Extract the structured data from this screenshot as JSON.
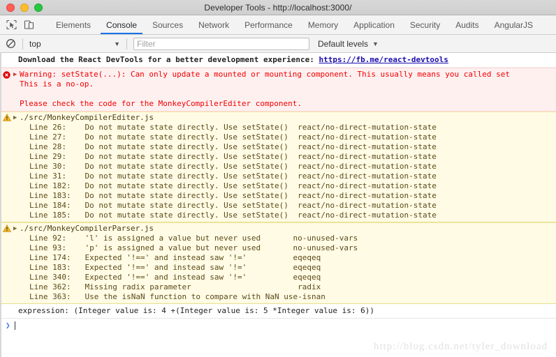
{
  "window": {
    "title": "Developer Tools - http://localhost:3000/",
    "traffic_lights": [
      "close",
      "minimize",
      "zoom"
    ],
    "colors": {
      "close": "#ff5f57",
      "minimize": "#ffbd2e",
      "zoom": "#28c840",
      "accent": "#1a73e8"
    }
  },
  "toolbar": {
    "inspect_icon": "inspect-cursor-icon",
    "device_icon": "device-toolbar-icon",
    "tabs": [
      {
        "label": "Elements",
        "active": false
      },
      {
        "label": "Console",
        "active": true
      },
      {
        "label": "Sources",
        "active": false
      },
      {
        "label": "Network",
        "active": false
      },
      {
        "label": "Performance",
        "active": false
      },
      {
        "label": "Memory",
        "active": false
      },
      {
        "label": "Application",
        "active": false
      },
      {
        "label": "Security",
        "active": false
      },
      {
        "label": "Audits",
        "active": false
      },
      {
        "label": "AngularJS",
        "active": false
      }
    ]
  },
  "filterbar": {
    "clear_icon": "clear-console-icon",
    "context": "top",
    "context_caret": "▼",
    "filter_value": "",
    "filter_placeholder": "Filter",
    "levels_label": "Default levels",
    "levels_caret": "▼"
  },
  "console": {
    "info_message": {
      "text_before": "Download the React DevTools for a better development experience: ",
      "link": "https://fb.me/react-devtools"
    },
    "error_message": {
      "icon": "error-circle-icon",
      "disclosure": "▶",
      "line1": "Warning: setState(...): Can only update a mounted or mounting component. This usually means you called set",
      "line2": "This is a no-op.",
      "line3": "Please check the code for the MonkeyCompilerEditer component."
    },
    "warning_groups": [
      {
        "icon": "warning-triangle-icon",
        "disclosure": "▶",
        "file": "./src/MonkeyCompilerEditer.js",
        "entries": [
          {
            "line": "Line 26:",
            "message": "Do not mutate state directly. Use setState()",
            "rule": "react/no-direct-mutation-state"
          },
          {
            "line": "Line 27:",
            "message": "Do not mutate state directly. Use setState()",
            "rule": "react/no-direct-mutation-state"
          },
          {
            "line": "Line 28:",
            "message": "Do not mutate state directly. Use setState()",
            "rule": "react/no-direct-mutation-state"
          },
          {
            "line": "Line 29:",
            "message": "Do not mutate state directly. Use setState()",
            "rule": "react/no-direct-mutation-state"
          },
          {
            "line": "Line 30:",
            "message": "Do not mutate state directly. Use setState()",
            "rule": "react/no-direct-mutation-state"
          },
          {
            "line": "Line 31:",
            "message": "Do not mutate state directly. Use setState()",
            "rule": "react/no-direct-mutation-state"
          },
          {
            "line": "Line 182:",
            "message": "Do not mutate state directly. Use setState()",
            "rule": "react/no-direct-mutation-state"
          },
          {
            "line": "Line 183:",
            "message": "Do not mutate state directly. Use setState()",
            "rule": "react/no-direct-mutation-state"
          },
          {
            "line": "Line 184:",
            "message": "Do not mutate state directly. Use setState()",
            "rule": "react/no-direct-mutation-state"
          },
          {
            "line": "Line 185:",
            "message": "Do not mutate state directly. Use setState()",
            "rule": "react/no-direct-mutation-state"
          }
        ]
      },
      {
        "icon": "warning-triangle-icon",
        "disclosure": "▶",
        "file": "./src/MonkeyCompilerParser.js",
        "entries": [
          {
            "line": "Line 92:",
            "message": "'l' is assigned a value but never used",
            "rule": "no-unused-vars"
          },
          {
            "line": "Line 93:",
            "message": "'p' is assigned a value but never used",
            "rule": "no-unused-vars"
          },
          {
            "line": "Line 174:",
            "message": "Expected '!==' and instead saw '!='",
            "rule": "eqeqeq"
          },
          {
            "line": "Line 183:",
            "message": "Expected '!==' and instead saw '!='",
            "rule": "eqeqeq"
          },
          {
            "line": "Line 340:",
            "message": "Expected '!==' and instead saw '!='",
            "rule": "eqeqeq"
          },
          {
            "line": "Line 362:",
            "message": "Missing radix parameter",
            "rule": "radix"
          },
          {
            "line": "Line 363:",
            "message": "Use the isNaN function to compare with NaN",
            "rule": "use-isnan"
          }
        ]
      }
    ],
    "expression_output": "expression: (Integer value is: 4 +(Integer value is: 5 *Integer value is: 6))",
    "prompt": {
      "caret": "❯",
      "value": ""
    }
  },
  "watermark": "http://blog.csdn.net/tyler_download"
}
